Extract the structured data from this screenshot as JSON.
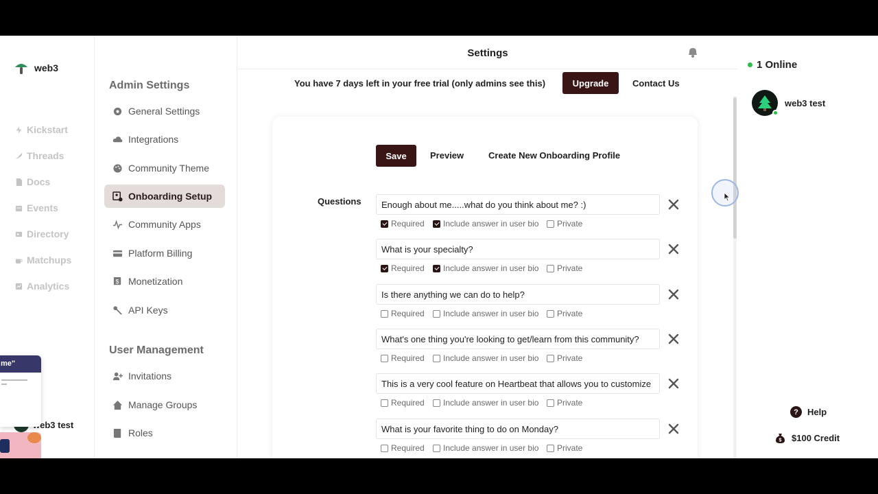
{
  "brand": {
    "name": "web3"
  },
  "nav": {
    "items": [
      {
        "label": "Kickstart",
        "icon": "bolt-icon"
      },
      {
        "label": "Threads",
        "icon": "feather-icon"
      },
      {
        "label": "Docs",
        "icon": "doc-icon"
      },
      {
        "label": "Events",
        "icon": "calendar-icon"
      },
      {
        "label": "Directory",
        "icon": "contact-card-icon"
      },
      {
        "label": "Matchups",
        "icon": "coffee-icon"
      },
      {
        "label": "Analytics",
        "icon": "chart-icon"
      }
    ]
  },
  "settings": {
    "admin_title": "Admin Settings",
    "admin_items": [
      {
        "label": "General Settings",
        "icon": "gear-icon"
      },
      {
        "label": "Integrations",
        "icon": "cloud-icon"
      },
      {
        "label": "Community Theme",
        "icon": "palette-icon"
      },
      {
        "label": "Onboarding Setup",
        "icon": "onboarding-icon",
        "active": true
      },
      {
        "label": "Community Apps",
        "icon": "pulse-icon"
      },
      {
        "label": "Platform Billing",
        "icon": "credit-card-icon"
      },
      {
        "label": "Monetization",
        "icon": "dollar-icon"
      },
      {
        "label": "API Keys",
        "icon": "key-icon"
      }
    ],
    "user_title": "User Management",
    "user_items": [
      {
        "label": "Invitations",
        "icon": "user-plus-icon"
      },
      {
        "label": "Manage Groups",
        "icon": "home-icon"
      },
      {
        "label": "Roles",
        "icon": "book-icon"
      }
    ]
  },
  "header": {
    "title": "Settings",
    "trial_text": "You have 7 days left in your free trial (only admins see this)",
    "upgrade_label": "Upgrade",
    "contact_label": "Contact Us"
  },
  "toolbar": {
    "save_label": "Save",
    "preview_label": "Preview",
    "create_label": "Create New Onboarding Profile"
  },
  "questions": {
    "label": "Questions",
    "option_labels": {
      "required": "Required",
      "bio": "Include answer in user bio",
      "private": "Private"
    },
    "items": [
      {
        "text": "Enough about me.....what do you think about me?  :)",
        "required": true,
        "bio": true,
        "private": false
      },
      {
        "text": "What is your specialty?",
        "required": true,
        "bio": true,
        "private": false
      },
      {
        "text": "Is there anything we can do to help?",
        "required": false,
        "bio": false,
        "private": false
      },
      {
        "text": "What's one thing you're looking to get/learn from this community?",
        "required": false,
        "bio": false,
        "private": false
      },
      {
        "text": "This is a very cool feature on Heartbeat that allows you to customize",
        "required": false,
        "bio": false,
        "private": false
      },
      {
        "text": "What is your favorite thing to do on Monday?",
        "required": false,
        "bio": false,
        "private": false
      }
    ]
  },
  "right": {
    "online_label": "1 Online",
    "user_name": "web3 test",
    "help_label": "Help",
    "credit_label": "$100 Credit"
  },
  "overlay": {
    "thumb_title": "me\"",
    "ghost_user": "web3 test"
  },
  "colors": {
    "accent": "#3a1516",
    "online": "#2dbd4f",
    "active_bg": "#e4dcdb"
  }
}
